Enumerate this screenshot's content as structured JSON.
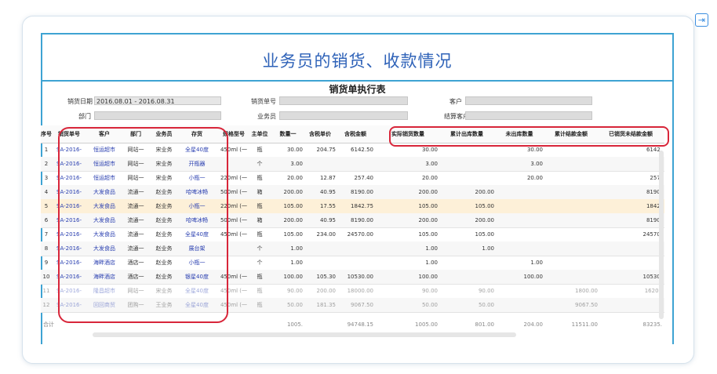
{
  "header": {
    "title": "业务员的销货、收款情况",
    "subtitle": "销货单执行表"
  },
  "filters": {
    "date_label": "销货日期",
    "date_value": "2016.08.01 - 2016.08.31",
    "dept_label": "部门",
    "dept_value": "",
    "order_label": "销货单号",
    "order_value": "",
    "salesman_label": "业务员",
    "salesman_value": "",
    "customer_label": "客户",
    "customer_value": "",
    "settle_label": "结算客户",
    "settle_value": ""
  },
  "columns": [
    "序号",
    "销货单号",
    "客户",
    "部门",
    "业务员",
    "存货",
    "规格型号",
    "主单位",
    "数量一",
    "含税单价",
    "含税金额",
    "实际销货数量",
    "累计出库数量",
    "未出库数量",
    "累计结款金额",
    "已销货未结款金额"
  ],
  "rows": [
    {
      "no": "1",
      "order": "SA-2016-",
      "cust": "恒运超市",
      "dept": "网站一",
      "rep": "宋业务",
      "item": "全星40度",
      "spec": "450ml (一",
      "unit": "瓶",
      "qty": "30.00",
      "price": "204.75",
      "amount": "6142.50",
      "actual": "30.00",
      "out": "",
      "notout": "30.00",
      "settled": "",
      "unsettled": "6142."
    },
    {
      "no": "2",
      "order": "SA-2016-",
      "cust": "恒运超市",
      "dept": "网站一",
      "rep": "宋业务",
      "item": "开瓶器",
      "spec": "",
      "unit": "个",
      "qty": "3.00",
      "price": "",
      "amount": "",
      "actual": "3.00",
      "out": "",
      "notout": "3.00",
      "settled": "",
      "unsettled": ""
    },
    {
      "no": "3",
      "order": "SA-2016-",
      "cust": "恒运超市",
      "dept": "网站一",
      "rep": "宋业务",
      "item": "小瓶一",
      "spec": "220ml (一",
      "unit": "瓶",
      "qty": "20.00",
      "price": "12.87",
      "amount": "257.40",
      "actual": "20.00",
      "out": "",
      "notout": "20.00",
      "settled": "",
      "unsettled": "257."
    },
    {
      "no": "4",
      "order": "SA-2016-",
      "cust": "大发食品",
      "dept": "流通一",
      "rep": "赵业务",
      "item": "哈啤冰畅",
      "spec": "500ml (一",
      "unit": "箱",
      "qty": "200.00",
      "price": "40.95",
      "amount": "8190.00",
      "actual": "200.00",
      "out": "200.00",
      "notout": "",
      "settled": "",
      "unsettled": "8190."
    },
    {
      "no": "5",
      "order": "SA-2016-",
      "cust": "大发食品",
      "dept": "流通一",
      "rep": "赵业务",
      "item": "小瓶一",
      "spec": "220ml (一",
      "unit": "瓶",
      "qty": "105.00",
      "price": "17.55",
      "amount": "1842.75",
      "actual": "105.00",
      "out": "105.00",
      "notout": "",
      "settled": "",
      "unsettled": "1842."
    },
    {
      "no": "6",
      "order": "SA-2016-",
      "cust": "大发食品",
      "dept": "流通一",
      "rep": "赵业务",
      "item": "哈啤冰畅",
      "spec": "500ml (一",
      "unit": "箱",
      "qty": "200.00",
      "price": "40.95",
      "amount": "8190.00",
      "actual": "200.00",
      "out": "200.00",
      "notout": "",
      "settled": "",
      "unsettled": "8190."
    },
    {
      "no": "7",
      "order": "SA-2016-",
      "cust": "大发食品",
      "dept": "流通一",
      "rep": "赵业务",
      "item": "全星40度",
      "spec": "450ml (一",
      "unit": "瓶",
      "qty": "105.00",
      "price": "234.00",
      "amount": "24570.00",
      "actual": "105.00",
      "out": "105.00",
      "notout": "",
      "settled": "",
      "unsettled": "24570."
    },
    {
      "no": "8",
      "order": "SA-2016-",
      "cust": "大发食品",
      "dept": "流通一",
      "rep": "赵业务",
      "item": "展台架",
      "spec": "",
      "unit": "个",
      "qty": "1.00",
      "price": "",
      "amount": "",
      "actual": "1.00",
      "out": "1.00",
      "notout": "",
      "settled": "",
      "unsettled": ""
    },
    {
      "no": "9",
      "order": "SA-2016-",
      "cust": "海畔酒店",
      "dept": "酒店一",
      "rep": "赵业务",
      "item": "小瓶一",
      "spec": "",
      "unit": "个",
      "qty": "1.00",
      "price": "",
      "amount": "",
      "actual": "1.00",
      "out": "",
      "notout": "1.00",
      "settled": "",
      "unsettled": ""
    },
    {
      "no": "10",
      "order": "SA-2016-",
      "cust": "海畔酒店",
      "dept": "酒店一",
      "rep": "赵业务",
      "item": "银星40度",
      "spec": "450ml (一",
      "unit": "瓶",
      "qty": "100.00",
      "price": "105.30",
      "amount": "10530.00",
      "actual": "100.00",
      "out": "",
      "notout": "100.00",
      "settled": "",
      "unsettled": "10530."
    },
    {
      "no": "11",
      "order": "SA-2016-",
      "cust": "隆昌超市",
      "dept": "网站一",
      "rep": "宋业务",
      "item": "全星40度",
      "spec": "450ml (一",
      "unit": "瓶",
      "qty": "90.00",
      "price": "200.00",
      "amount": "18000.00",
      "actual": "90.00",
      "out": "90.00",
      "notout": "",
      "settled": "1800.00",
      "unsettled": "16200"
    },
    {
      "no": "12",
      "order": "SA-2016-",
      "cust": "回回商贸",
      "dept": "团购一",
      "rep": "王业务",
      "item": "全星40度",
      "spec": "450ml (一",
      "unit": "瓶",
      "qty": "50.00",
      "price": "181.35",
      "amount": "9067.50",
      "actual": "50.00",
      "out": "50.00",
      "notout": "",
      "settled": "9067.50",
      "unsettled": ""
    }
  ],
  "totals": {
    "label": "合计",
    "qty": "1005.",
    "amount": "94748.15",
    "actual": "1005.00",
    "out": "801.00",
    "notout": "204.00",
    "settled": "11511.00",
    "unsettled": "83235."
  }
}
